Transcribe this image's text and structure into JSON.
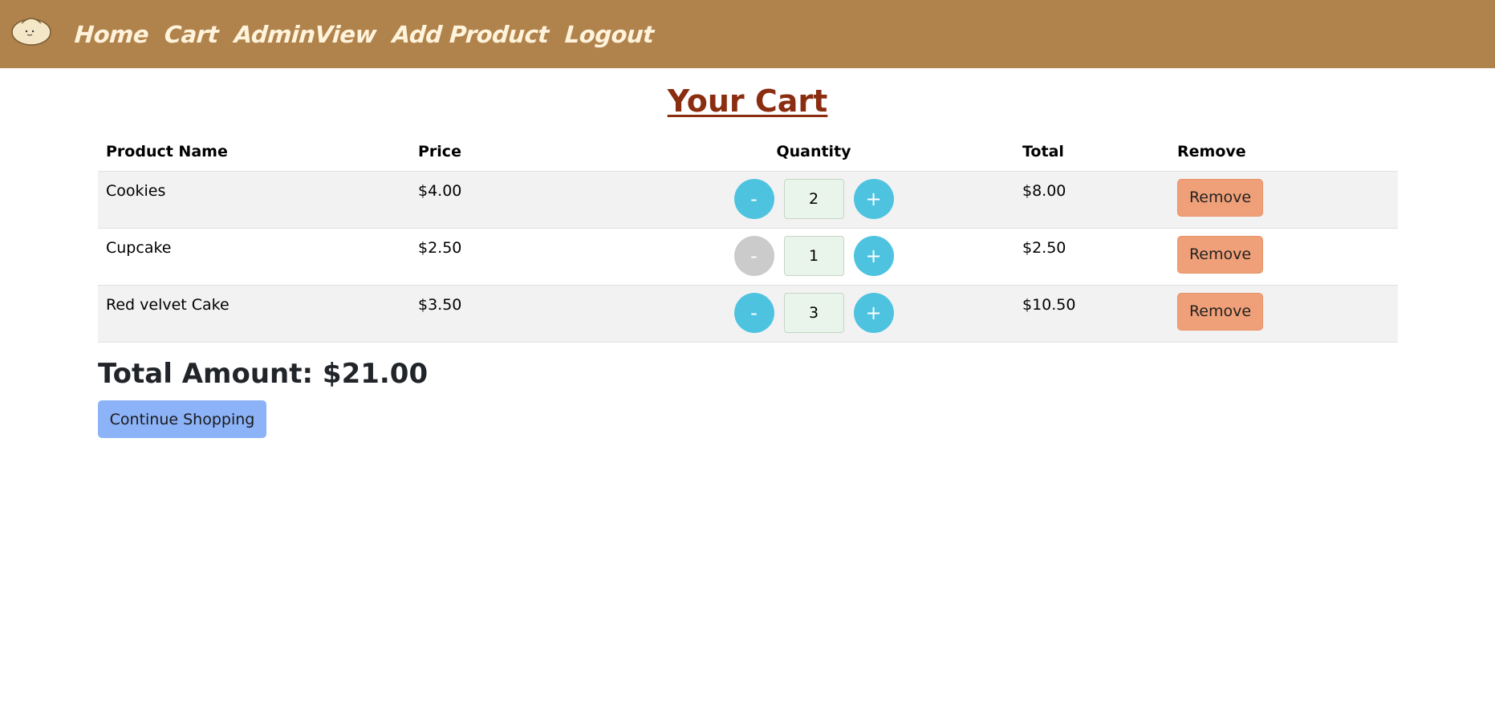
{
  "nav": {
    "links": [
      "Home",
      "Cart",
      "AdminView",
      "Add Product",
      "Logout"
    ]
  },
  "page": {
    "title": "Your Cart"
  },
  "table": {
    "headers": [
      "Product Name",
      "Price",
      "Quantity",
      "Total",
      "Remove"
    ],
    "rows": [
      {
        "name": "Cookies",
        "price": "$4.00",
        "quantity": "2",
        "total": "$8.00",
        "minus": "-",
        "plus": "+",
        "remove": "Remove"
      },
      {
        "name": "Cupcake",
        "price": "$2.50",
        "quantity": "1",
        "total": "$2.50",
        "minus": "-",
        "plus": "+",
        "remove": "Remove"
      },
      {
        "name": "Red velvet Cake",
        "price": "$3.50",
        "quantity": "3",
        "total": "$10.50",
        "minus": "-",
        "plus": "+",
        "remove": "Remove"
      }
    ]
  },
  "summary": {
    "total_amount": "Total Amount: $21.00",
    "continue_label": "Continue Shopping"
  },
  "colors": {
    "navbar": "#b1834c",
    "title": "#8b2d10",
    "qty_button": "#4ec3e0",
    "qty_button_disabled": "#cbcbcb",
    "remove_button": "#f0a078",
    "continue_button": "#8cb2f7"
  }
}
